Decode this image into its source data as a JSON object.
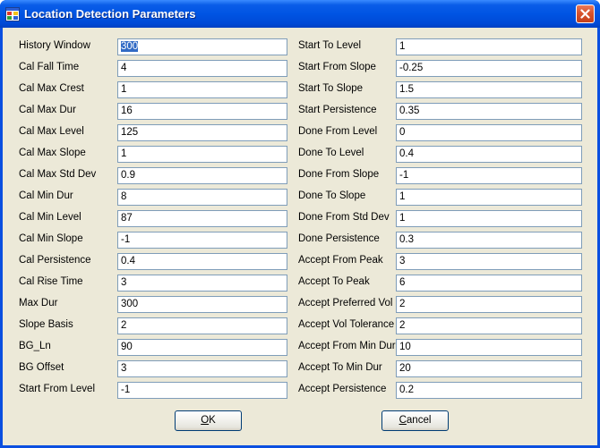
{
  "window": {
    "title": "Location Detection Parameters"
  },
  "left_fields": [
    {
      "label": "History Window",
      "value": "300"
    },
    {
      "label": "Cal Fall Time",
      "value": "4"
    },
    {
      "label": "Cal Max Crest",
      "value": "1"
    },
    {
      "label": "Cal Max Dur",
      "value": "16"
    },
    {
      "label": "Cal Max Level",
      "value": "125"
    },
    {
      "label": "Cal Max Slope",
      "value": "1"
    },
    {
      "label": "Cal Max Std Dev",
      "value": "0.9"
    },
    {
      "label": "Cal Min Dur",
      "value": "8"
    },
    {
      "label": "Cal Min Level",
      "value": "87"
    },
    {
      "label": "Cal Min Slope",
      "value": "-1"
    },
    {
      "label": "Cal Persistence",
      "value": "0.4"
    },
    {
      "label": "Cal Rise Time",
      "value": "3"
    },
    {
      "label": "Max Dur",
      "value": "300"
    },
    {
      "label": "Slope Basis",
      "value": "2"
    },
    {
      "label": "BG_Ln",
      "value": "90"
    },
    {
      "label": "BG Offset",
      "value": "3"
    },
    {
      "label": "Start From Level",
      "value": "-1"
    }
  ],
  "right_fields": [
    {
      "label": "Start To Level",
      "value": "1"
    },
    {
      "label": "Start From Slope",
      "value": "-0.25"
    },
    {
      "label": "Start To Slope",
      "value": "1.5"
    },
    {
      "label": "Start Persistence",
      "value": "0.35"
    },
    {
      "label": "Done From Level",
      "value": "0"
    },
    {
      "label": "Done To Level",
      "value": "0.4"
    },
    {
      "label": "Done From Slope",
      "value": "-1"
    },
    {
      "label": "Done To Slope",
      "value": "1"
    },
    {
      "label": "Done From Std Dev",
      "value": "1"
    },
    {
      "label": "Done Persistence",
      "value": "0.3"
    },
    {
      "label": "Accept From Peak",
      "value": "3"
    },
    {
      "label": "Accept To Peak",
      "value": "6"
    },
    {
      "label": "Accept Preferred Vol",
      "value": "2"
    },
    {
      "label": "Accept Vol Tolerance",
      "value": "2"
    },
    {
      "label": "Accept From Min Dur",
      "value": "10"
    },
    {
      "label": "Accept To Min Dur",
      "value": "20"
    },
    {
      "label": "Accept Persistence",
      "value": "0.2"
    }
  ],
  "buttons": {
    "ok": {
      "accel": "O",
      "rest": "K"
    },
    "cancel": {
      "accel": "C",
      "rest": "ancel"
    }
  },
  "colors": {
    "titlebar": "#0054e3",
    "client_bg": "#ece9d8",
    "close_button": "#d8532d",
    "selection": "#316ac5",
    "field_border": "#7f9db9"
  },
  "icons": {
    "app": "app-window-icon",
    "close": "close-x-icon"
  }
}
